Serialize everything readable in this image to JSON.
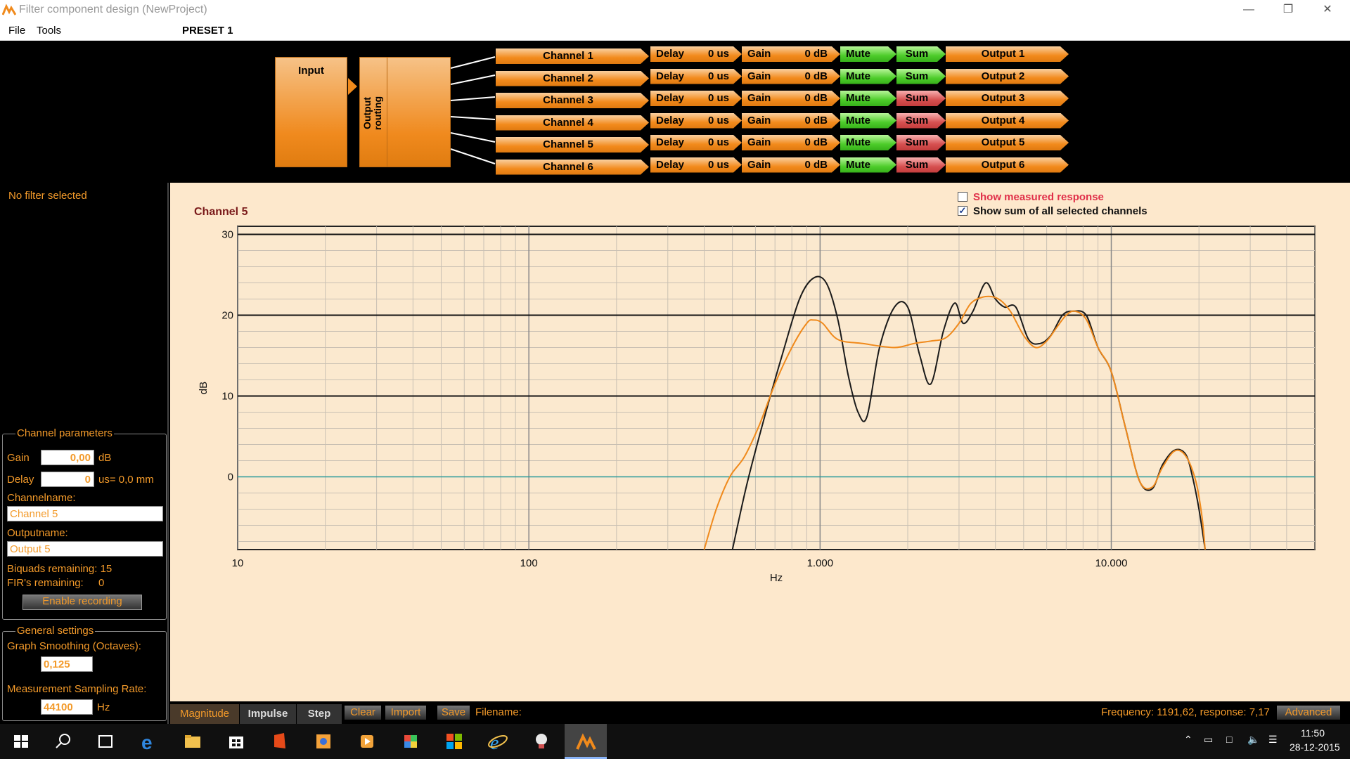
{
  "window": {
    "title": "Filter component design (NewProject)"
  },
  "menu": {
    "file": "File",
    "tools": "Tools",
    "preset": "PRESET 1"
  },
  "routing": {
    "input_label": "Input",
    "output_routing_label": "Output routing",
    "channels": [
      {
        "name": "Channel 1",
        "delay_label": "Delay",
        "delay_value": "0 us",
        "gain_label": "Gain",
        "gain_value": "0 dB",
        "mute_label": "Mute",
        "sum_label": "Sum",
        "sum_state": "green",
        "output": "Output 1"
      },
      {
        "name": "Channel 2",
        "delay_label": "Delay",
        "delay_value": "0 us",
        "gain_label": "Gain",
        "gain_value": "0 dB",
        "mute_label": "Mute",
        "sum_label": "Sum",
        "sum_state": "green",
        "output": "Output 2"
      },
      {
        "name": "Channel 3",
        "delay_label": "Delay",
        "delay_value": "0 us",
        "gain_label": "Gain",
        "gain_value": "0 dB",
        "mute_label": "Mute",
        "sum_label": "Sum",
        "sum_state": "red",
        "output": "Output 3"
      },
      {
        "name": "Channel 4",
        "delay_label": "Delay",
        "delay_value": "0 us",
        "gain_label": "Gain",
        "gain_value": "0 dB",
        "mute_label": "Mute",
        "sum_label": "Sum",
        "sum_state": "red",
        "output": "Output 4"
      },
      {
        "name": "Channel 5",
        "delay_label": "Delay",
        "delay_value": "0 us",
        "gain_label": "Gain",
        "gain_value": "0 dB",
        "mute_label": "Mute",
        "sum_label": "Sum",
        "sum_state": "red",
        "output": "Output 5"
      },
      {
        "name": "Channel 6",
        "delay_label": "Delay",
        "delay_value": "0 us",
        "gain_label": "Gain",
        "gain_value": "0 dB",
        "mute_label": "Mute",
        "sum_label": "Sum",
        "sum_state": "red",
        "output": "Output 6"
      }
    ]
  },
  "left": {
    "no_filter": "No filter selected",
    "channel_params": {
      "legend": "Channel parameters",
      "gain_label": "Gain",
      "gain_value": "0,00",
      "gain_unit": "dB",
      "delay_label": "Delay",
      "delay_value": "0",
      "delay_unit": "us= 0,0 mm",
      "channelname_label": "Channelname:",
      "channelname_value": "Channel 5",
      "outputname_label": "Outputname:",
      "outputname_value": "Output 5",
      "biquads_label": "Biquads remaining: 15",
      "firs_label": "FIR's remaining:",
      "firs_value": "0",
      "record_button": "Enable recording"
    },
    "general": {
      "legend": "General settings",
      "smoothing_label": "Graph Smoothing (Octaves):",
      "smoothing_value": "0,125",
      "sampling_label": "Measurement Sampling Rate:",
      "sampling_value": "44100",
      "sampling_unit": "Hz"
    }
  },
  "graph": {
    "title": "Channel 5",
    "show_measured_label": "Show measured response",
    "show_measured_checked": false,
    "show_sum_label": "Show sum of all selected channels",
    "show_sum_checked": true
  },
  "chart_data": {
    "type": "line",
    "title": "Channel 5",
    "xlabel": "Hz",
    "ylabel": "dB",
    "xscale": "log",
    "xlim": [
      10,
      50000
    ],
    "ylim": [
      -9,
      31
    ],
    "xticks": [
      "10",
      "100",
      "1.000",
      "10.000"
    ],
    "xtick_values": [
      10,
      100,
      1000,
      10000
    ],
    "yticks": [
      0,
      10,
      20,
      30
    ],
    "grid": true,
    "zero_line_color": "#2a9a9a",
    "series": [
      {
        "color": "#1a1a1a",
        "x": [
          500,
          560,
          640,
          740,
          850,
          950,
          1050,
          1150,
          1250,
          1350,
          1450,
          1600,
          1800,
          2000,
          2200,
          2400,
          2650,
          2900,
          3100,
          3350,
          3700,
          4000,
          4300,
          4700,
          5200,
          5700,
          6200,
          6800,
          7400,
          8200,
          9000,
          10000,
          11200,
          12500,
          13800,
          15000,
          16500,
          18000,
          19000,
          20000,
          21000
        ],
        "y": [
          -9,
          -1,
          7,
          15,
          22,
          24.6,
          24,
          19.5,
          12.5,
          8,
          7.5,
          16,
          21,
          21,
          15,
          11.5,
          18,
          21.5,
          19,
          20.5,
          24,
          22,
          21,
          21,
          17,
          16.5,
          17.5,
          20,
          20.5,
          20,
          16,
          13,
          6,
          -0.5,
          -1.5,
          1.5,
          3.3,
          2.8,
          0,
          -4,
          -9
        ]
      },
      {
        "color": "#f08a1c",
        "x": [
          400,
          440,
          490,
          550,
          620,
          700,
          800,
          900,
          950,
          1020,
          1150,
          1400,
          1800,
          2100,
          2400,
          2700,
          3000,
          3300,
          3700,
          4100,
          4500,
          5000,
          5500,
          6000,
          6500,
          7000,
          7500,
          8200,
          9000,
          10000,
          11200,
          12500,
          13800,
          15000,
          16500,
          18000,
          19500,
          20500,
          21000
        ],
        "y": [
          -9,
          -4,
          0,
          2.5,
          6.5,
          11.5,
          16,
          19,
          19.4,
          19,
          17,
          16.5,
          16,
          16.5,
          16.8,
          17.2,
          19,
          21.5,
          22.3,
          22,
          20.5,
          17.5,
          16,
          16.8,
          18.5,
          20,
          20.5,
          19.5,
          16,
          13,
          6,
          -0.5,
          -1.3,
          1.2,
          3.2,
          2.6,
          -0.5,
          -5,
          -9
        ]
      }
    ]
  },
  "bottom": {
    "tabs": [
      "Magnitude",
      "Impulse",
      "Step"
    ],
    "clear": "Clear",
    "import": "Import",
    "save": "Save",
    "filename_label": "Filename:",
    "status": "Frequency: 1191,62, response: 7,17",
    "advanced": "Advanced"
  },
  "taskbar": {
    "time": "11:50",
    "date": "28-12-2015"
  }
}
